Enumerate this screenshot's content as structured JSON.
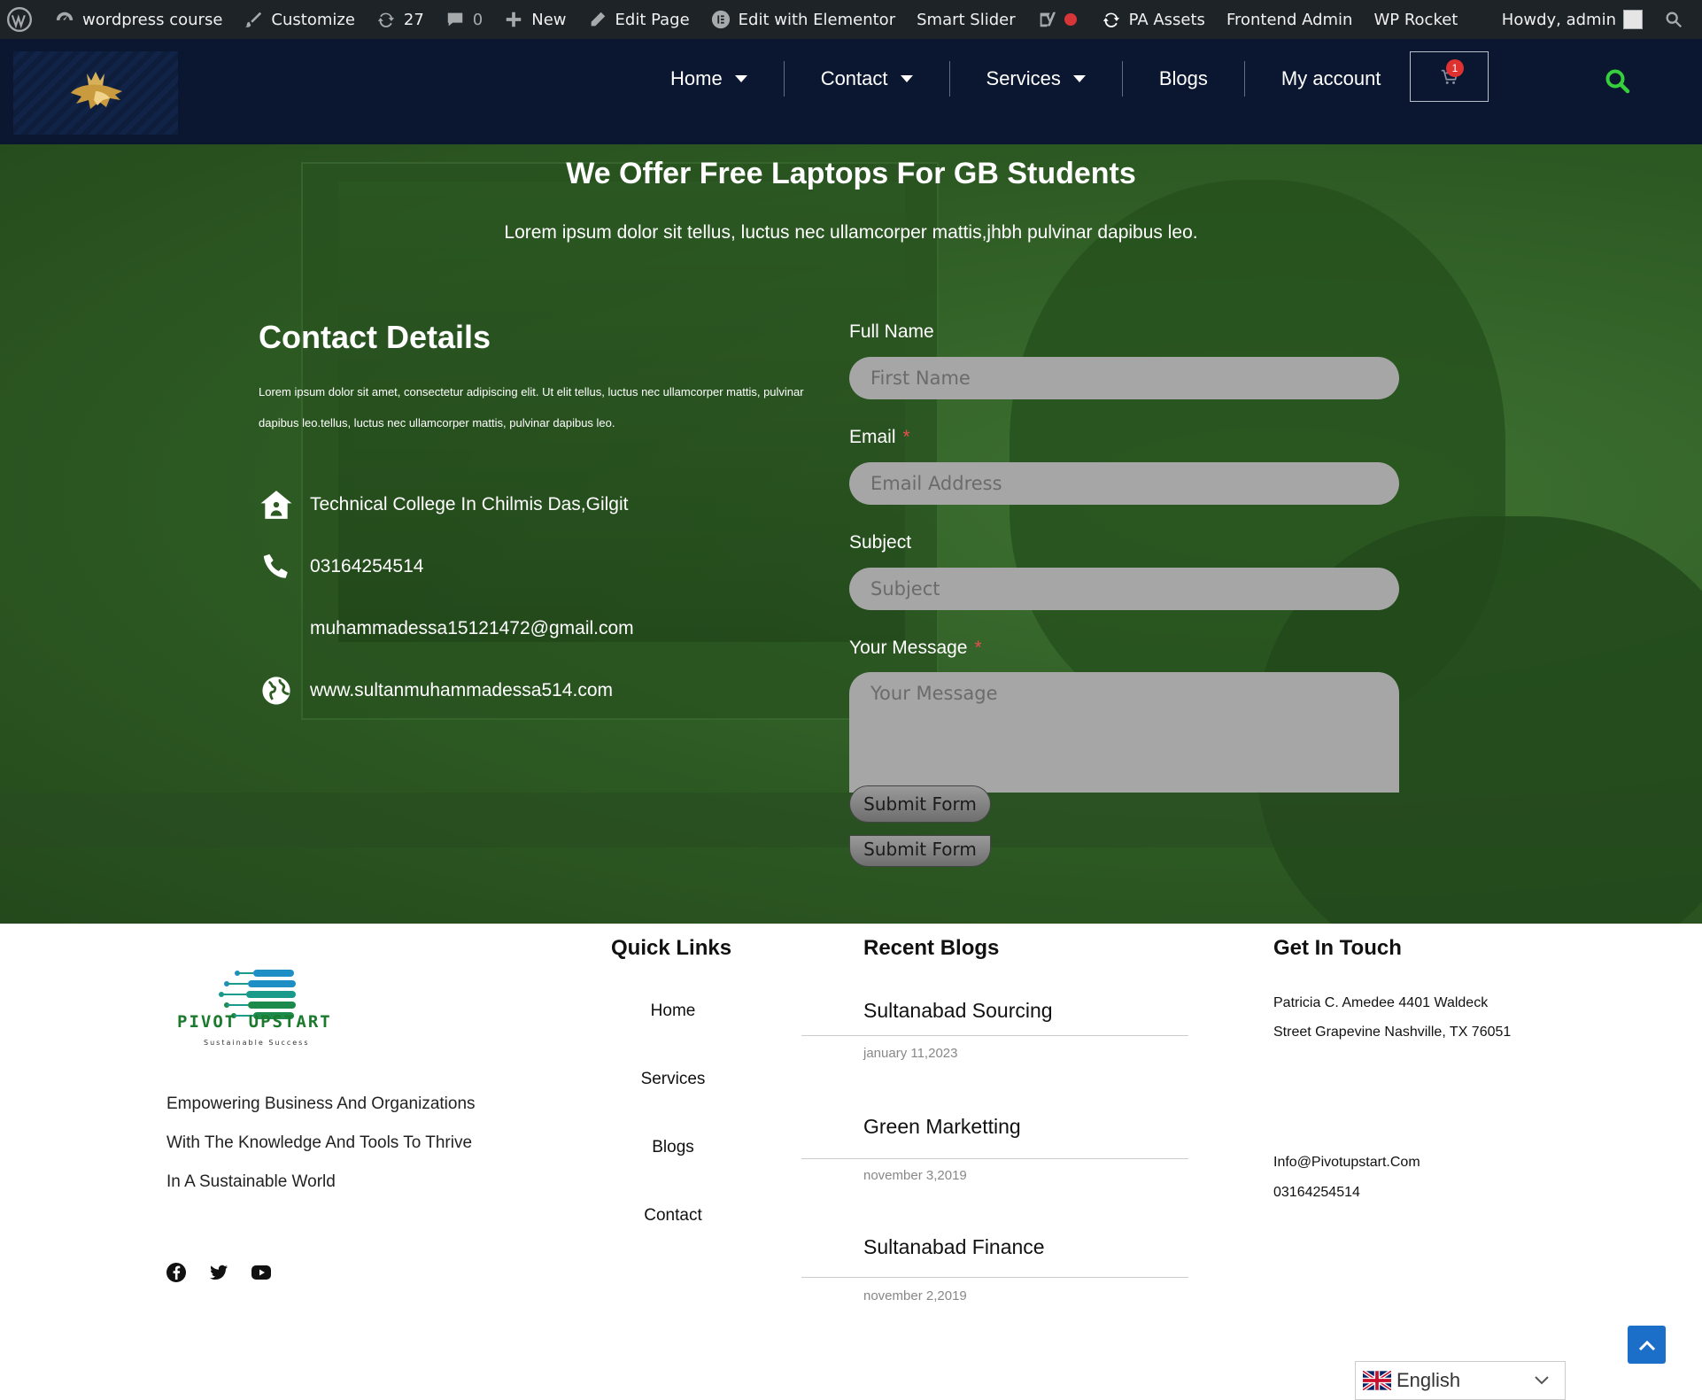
{
  "admin_bar": {
    "site_name": "wordpress course",
    "customize": "Customize",
    "updates_count": "27",
    "comments_count": "0",
    "new": "New",
    "edit_page": "Edit Page",
    "edit_elementor": "Edit with Elementor",
    "smart_slider": "Smart Slider",
    "pa_assets": "PA Assets",
    "frontend_admin": "Frontend Admin",
    "wp_rocket": "WP Rocket",
    "howdy": "Howdy, admin"
  },
  "nav": {
    "items": [
      {
        "label": "Home",
        "dropdown": true
      },
      {
        "label": "Contact",
        "dropdown": true
      },
      {
        "label": "Services",
        "dropdown": true
      },
      {
        "label": "Blogs",
        "dropdown": false
      },
      {
        "label": "My account",
        "dropdown": false
      }
    ],
    "cart_count": "1"
  },
  "hero": {
    "title": "We Offer Free Laptops For GB Students",
    "subtitle": "Lorem ipsum dolor   sit  tellus, luctus nec ullamcorper mattis,jhbh pulvinar dapibus leo."
  },
  "contact": {
    "title": "Contact Details",
    "description": "Lorem ipsum dolor sit amet, consectetur adipiscing elit. Ut elit tellus, luctus nec ullamcorper mattis, pulvinar dapibus leo.tellus, luctus nec ullamcorper mattis, pulvinar dapibus leo.",
    "address": "Technical College In Chilmis Das,Gilgit",
    "phone": "03164254514",
    "email": "muhammadessa15121472@gmail.com",
    "website": "www.sultanmuhammadessa514.com"
  },
  "form": {
    "name_label": "Full Name",
    "name_placeholder": "First Name",
    "email_label": "Email",
    "email_placeholder": "Email Address",
    "subject_label": "Subject",
    "subject_placeholder": "Subject",
    "message_label": "Your Message",
    "message_placeholder": "Your Message",
    "required_mark": "*",
    "submit": "Submit Form"
  },
  "footer": {
    "brand": "PIVOT UPSTART",
    "brand_tagline": "Sustainable Success",
    "about": "Empowering Business And Organizations With The Knowledge And Tools To Thrive In A Sustainable World",
    "quick_links_title": "Quick Links",
    "quick_links": [
      "Home",
      "Services",
      "Blogs",
      "Contact"
    ],
    "recent_blogs_title": "Recent Blogs",
    "blogs": [
      {
        "title": "Sultanabad Sourcing",
        "date": "january 11,2023"
      },
      {
        "title": "Green Marketting",
        "date": "november 3,2019"
      },
      {
        "title": "Sultanabad Finance",
        "date": "november 2,2019"
      }
    ],
    "get_in_touch_title": "Get In Touch",
    "address_line1": "Patricia C. Amedee 4401 Waldeck",
    "address_line2": "Street Grapevine Nashville, TX 76051",
    "email": "Info@Pivotupstart.Com",
    "phone": "03164254514",
    "language": "English"
  }
}
